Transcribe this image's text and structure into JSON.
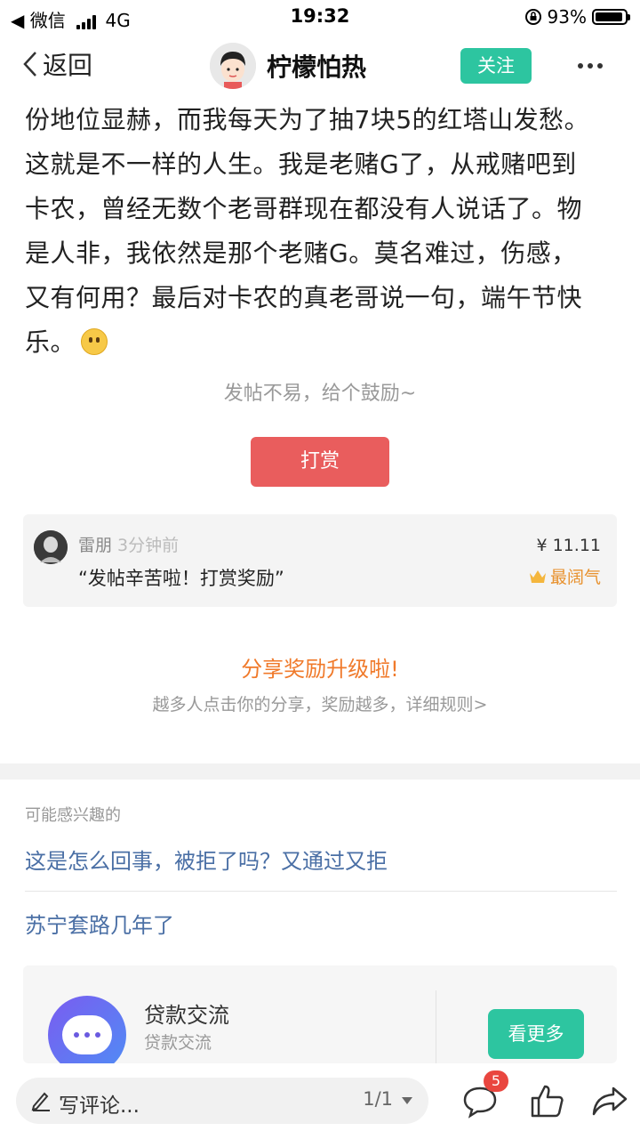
{
  "status_bar": {
    "carrier": "微信",
    "network": "4G",
    "time": "19:32",
    "battery": "93%",
    "battery_level": 0.93
  },
  "nav": {
    "back_label": "返回",
    "title": "柠檬怕热",
    "follow_label": "关注"
  },
  "article": {
    "lines": [
      "份地位显赫，而我每天为了抽7块5的红塔山发愁。",
      "这就是不一样的人生。我是老赌G了，从戒赌吧到",
      "卡农，曾经无数个老哥群现在都没有人说话了。物",
      "是人非，我依然是那个老赌G。莫名难过，伤感，",
      "又有何用？最后对卡农的真老哥说一句，端午节快",
      "乐。"
    ]
  },
  "reward_section": {
    "encourage_text": "发帖不易，给个鼓励~",
    "tip_button": "打赏",
    "record": {
      "user": "雷朋",
      "time": "3分钟前",
      "message": "“发帖辛苦啦！打赏奖励”",
      "amount": "¥ 11.11",
      "badge": "最阔气"
    }
  },
  "share": {
    "title": "分享奖励升级啦!",
    "subtitle": "越多人点击你的分享，奖励越多，详细规则>"
  },
  "related": {
    "heading": "可能感兴趣的",
    "items": [
      "这是怎么回事，被拒了吗？又通过又拒",
      "苏宁套路几年了"
    ]
  },
  "ad": {
    "title": "贷款交流",
    "subtitle": "贷款交流",
    "button": "看更多"
  },
  "bottom_bar": {
    "comment_placeholder": "写评论...",
    "page": "1/1",
    "comment_count": "5"
  },
  "colors": {
    "accent_green": "#2dc5a0",
    "tip_red": "#e95d5d",
    "share_orange": "#f07a2b",
    "link_blue": "#4a6fa5",
    "badge_red": "#e9463f"
  }
}
